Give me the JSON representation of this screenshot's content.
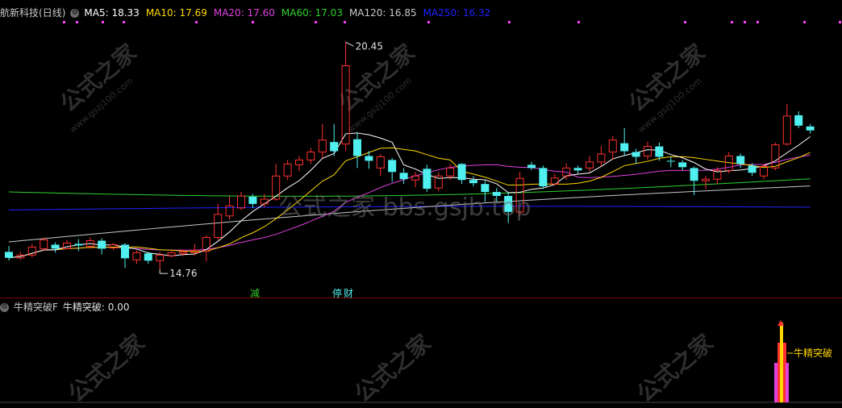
{
  "title": "航新科技",
  "period": "(日线)",
  "ma_header": [
    {
      "label": "MA5: 18.33",
      "color": "#ffffff"
    },
    {
      "label": "MA10: 17.69",
      "color": "#ffd700"
    },
    {
      "label": "MA20: 17.60",
      "color": "#e040e0"
    },
    {
      "label": "MA60: 17.03",
      "color": "#30d030"
    },
    {
      "label": "MA120: 16.85",
      "color": "#c8c8c8"
    },
    {
      "label": "MA250: 16.32",
      "color": "#2020ff"
    }
  ],
  "indicator": {
    "name": "牛精突破F",
    "value_label": "牛精突破: 0.00",
    "signal_label": "牛精突破"
  },
  "annotations": {
    "high": "20.45",
    "low": "14.76",
    "tag_reduce": "减",
    "tag_suspend": "停",
    "tag_finance": "财"
  },
  "watermark": {
    "center": "公式之家 bbs.gsjb.top",
    "tile": "公式之家",
    "tile_url": "www.gszj100.com"
  },
  "colors": {
    "up": "#ff3030",
    "down": "#50f0f0",
    "bg": "#000000",
    "grid": "#7a0000"
  },
  "chart_data": {
    "type": "candlestick",
    "y_range": [
      14.4,
      20.9
    ],
    "candles": [
      [
        15.2,
        15.05,
        15.35,
        14.98
      ],
      [
        15.05,
        15.12,
        15.2,
        15.0
      ],
      [
        15.12,
        15.32,
        15.4,
        15.06
      ],
      [
        15.28,
        15.5,
        15.56,
        15.22
      ],
      [
        15.38,
        15.28,
        15.44,
        15.18
      ],
      [
        15.28,
        15.42,
        15.5,
        15.26
      ],
      [
        15.4,
        15.36,
        15.52,
        15.22
      ],
      [
        15.34,
        15.48,
        15.56,
        15.28
      ],
      [
        15.48,
        15.28,
        15.54,
        15.14
      ],
      [
        15.3,
        15.38,
        15.42,
        15.24
      ],
      [
        15.38,
        15.04,
        15.42,
        14.8
      ],
      [
        15.0,
        15.18,
        15.24,
        14.9
      ],
      [
        15.16,
        14.98,
        15.2,
        14.9
      ],
      [
        14.98,
        15.12,
        15.2,
        14.76
      ],
      [
        15.1,
        15.18,
        15.22,
        15.06
      ],
      [
        15.16,
        15.2,
        15.26,
        15.1
      ],
      [
        15.18,
        15.24,
        15.4,
        15.12
      ],
      [
        15.22,
        15.56,
        15.62,
        14.96
      ],
      [
        15.56,
        16.14,
        16.4,
        15.5
      ],
      [
        16.1,
        16.35,
        16.6,
        16.0
      ],
      [
        16.3,
        16.6,
        16.7,
        16.25
      ],
      [
        16.58,
        16.4,
        16.65,
        16.3
      ],
      [
        16.4,
        16.52,
        16.65,
        16.32
      ],
      [
        16.52,
        17.1,
        17.4,
        16.48
      ],
      [
        17.1,
        17.4,
        17.5,
        17.0
      ],
      [
        17.38,
        17.5,
        17.6,
        17.22
      ],
      [
        17.5,
        17.7,
        17.8,
        17.4
      ],
      [
        17.7,
        18.0,
        18.4,
        17.55
      ],
      [
        17.95,
        17.72,
        18.4,
        17.6
      ],
      [
        17.9,
        19.86,
        20.45,
        17.72
      ],
      [
        18.02,
        17.6,
        18.2,
        17.3
      ],
      [
        17.6,
        17.48,
        17.72,
        17.28
      ],
      [
        17.3,
        17.58,
        17.65,
        17.1
      ],
      [
        17.5,
        17.2,
        17.55,
        16.95
      ],
      [
        17.18,
        17.02,
        17.3,
        16.9
      ],
      [
        17.0,
        17.1,
        17.2,
        16.82
      ],
      [
        17.28,
        16.78,
        17.38,
        16.7
      ],
      [
        16.8,
        17.1,
        17.2,
        16.72
      ],
      [
        17.1,
        17.3,
        17.4,
        17.0
      ],
      [
        17.4,
        17.0,
        17.42,
        16.9
      ],
      [
        17.0,
        16.92,
        17.1,
        16.84
      ],
      [
        16.9,
        16.7,
        16.98,
        16.45
      ],
      [
        16.7,
        16.6,
        16.8,
        16.45
      ],
      [
        16.6,
        16.2,
        16.7,
        15.92
      ],
      [
        16.2,
        17.04,
        17.2,
        16.1
      ],
      [
        17.38,
        17.3,
        17.45,
        17.25
      ],
      [
        17.3,
        16.84,
        17.36,
        16.78
      ],
      [
        16.9,
        17.05,
        17.15,
        16.86
      ],
      [
        17.1,
        17.3,
        17.42,
        17.0
      ],
      [
        17.3,
        17.24,
        17.36,
        17.16
      ],
      [
        17.3,
        17.45,
        17.6,
        17.2
      ],
      [
        17.45,
        17.65,
        17.85,
        17.35
      ],
      [
        17.7,
        18.0,
        18.1,
        17.5
      ],
      [
        17.92,
        17.72,
        18.3,
        17.6
      ],
      [
        17.7,
        17.58,
        17.78,
        17.4
      ],
      [
        17.6,
        17.84,
        17.96,
        17.5
      ],
      [
        17.84,
        17.58,
        17.94,
        17.48
      ],
      [
        17.48,
        17.46,
        17.58,
        17.32
      ],
      [
        17.44,
        17.32,
        17.5,
        17.24
      ],
      [
        17.3,
        16.98,
        17.34,
        16.62
      ],
      [
        16.98,
        17.02,
        17.1,
        16.78
      ],
      [
        17.02,
        17.24,
        17.32,
        16.9
      ],
      [
        17.24,
        17.6,
        17.7,
        17.16
      ],
      [
        17.6,
        17.4,
        17.66,
        17.3
      ],
      [
        17.36,
        17.18,
        17.42,
        17.1
      ],
      [
        17.1,
        17.34,
        17.4,
        17.02
      ],
      [
        17.3,
        17.88,
        17.94,
        17.24
      ],
      [
        17.9,
        18.6,
        18.9,
        17.86
      ],
      [
        18.62,
        18.36,
        18.72,
        18.3
      ],
      [
        18.34,
        18.24,
        18.4,
        18.16
      ]
    ]
  }
}
